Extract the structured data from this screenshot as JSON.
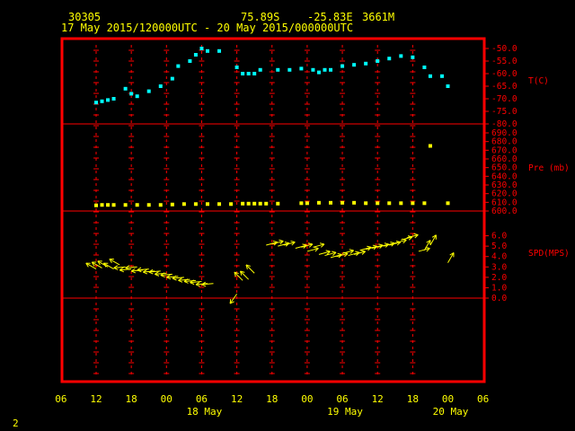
{
  "header": {
    "station": "30305",
    "lat": "75.89S",
    "lon": "-25.83E",
    "elevation": "3661M",
    "time_range": "17 May 2015/120000UTC - 20 May 2015/000000UTC"
  },
  "footer_number": "2",
  "colors": {
    "frame": "#ff0000",
    "temperature": "#00ffff",
    "pressure": "#ffff00",
    "wind": "#ffff00",
    "text": "#ffff00",
    "axis": "#ff0000"
  },
  "chart_data": [
    {
      "type": "scatter",
      "panel": "temperature",
      "ylabel": "T(C)",
      "ylim": [
        -80,
        -50
      ],
      "yticks": [
        "-50.0",
        "-55.0",
        "-60.0",
        "-65.0",
        "-70.0",
        "-75.0",
        "-80.0"
      ],
      "x_hours": [
        0,
        1,
        2,
        3,
        5,
        6,
        7,
        9,
        11,
        13,
        14,
        16,
        17,
        18,
        19,
        21,
        24,
        25,
        26,
        27,
        28,
        31,
        33,
        35,
        37,
        38,
        39,
        40,
        42,
        44,
        46,
        48,
        50,
        52,
        54,
        56,
        57,
        59,
        60
      ],
      "values": [
        -71.5,
        -71,
        -70.5,
        -70,
        -66,
        -68,
        -69,
        -67,
        -65,
        -62,
        -57,
        -55,
        -52.5,
        -50,
        -51,
        -51,
        -57.5,
        -60,
        -60,
        -60,
        -58.5,
        -58.5,
        -58.5,
        -58,
        -58.5,
        -59.5,
        -58.5,
        -58.5,
        -57,
        -56.5,
        -56,
        -55,
        -54,
        -53,
        -53.5,
        -57.5,
        -61,
        -61,
        -65
      ]
    },
    {
      "type": "scatter",
      "panel": "pressure",
      "ylabel": "Pre (mb)",
      "ylim": [
        600,
        690
      ],
      "yticks": [
        "690.0",
        "680.0",
        "670.0",
        "660.0",
        "650.0",
        "640.0",
        "630.0",
        "620.0",
        "610.0",
        "600.0"
      ],
      "x_hours": [
        0,
        1,
        2,
        3,
        5,
        7,
        9,
        11,
        13,
        15,
        17,
        19,
        21,
        23,
        25,
        26,
        27,
        28,
        29,
        31,
        35,
        36,
        38,
        40,
        42,
        44,
        46,
        48,
        50,
        52,
        54,
        56,
        57,
        60
      ],
      "values": [
        606.5,
        607,
        607,
        607,
        607,
        607,
        607,
        607,
        607.5,
        608,
        608,
        608,
        608,
        608,
        608.5,
        608.5,
        608.5,
        608.5,
        608.5,
        608.5,
        609,
        609,
        609.5,
        609.5,
        609.5,
        609.5,
        609,
        609,
        609,
        609,
        609,
        609,
        675,
        609
      ]
    },
    {
      "type": "scatter",
      "panel": "wind",
      "ylabel": "SPD(MPS)",
      "ylim": [
        0,
        7
      ],
      "yticks": [
        "6.0",
        "5.0",
        "4.0",
        "3.0",
        "2.0",
        "1.0",
        "0.0"
      ],
      "x_hours": [
        0,
        1,
        2,
        3,
        4,
        5,
        6,
        7,
        8,
        9,
        10,
        11,
        12,
        13,
        14,
        15,
        16,
        17,
        18,
        19,
        20,
        24,
        25,
        26,
        27,
        29,
        30,
        31,
        32,
        34,
        35,
        36,
        37,
        38,
        39,
        40,
        41,
        42,
        43,
        44,
        45,
        46,
        47,
        48,
        49,
        50,
        51,
        52,
        53,
        55,
        56,
        57,
        60
      ],
      "values": [
        2.8,
        2.9,
        3.0,
        2.8,
        3.2,
        3.0,
        2.8,
        3.0,
        2.7,
        2.8,
        2.6,
        2.6,
        2.4,
        2.3,
        2.1,
        2.0,
        1.8,
        1.7,
        1.6,
        1.4,
        1.4,
        0.4,
        1.7,
        1.8,
        2.4,
        5.1,
        5.2,
        5.0,
        5.1,
        4.8,
        4.9,
        4.5,
        4.9,
        4.2,
        4.1,
        3.9,
        4.0,
        4.3,
        4.1,
        4.2,
        4.6,
        4.7,
        4.8,
        4.9,
        5.0,
        5.1,
        5.3,
        5.6,
        5.8,
        4.5,
        4.6,
        5.1,
        3.4
      ]
    }
  ],
  "x_axis": {
    "tick_labels": [
      "06",
      "12",
      "18",
      "00",
      "06",
      "12",
      "18",
      "00",
      "06",
      "12",
      "18",
      "00",
      "06"
    ],
    "day_labels": [
      "18 May",
      "19 May",
      "20 May"
    ]
  }
}
